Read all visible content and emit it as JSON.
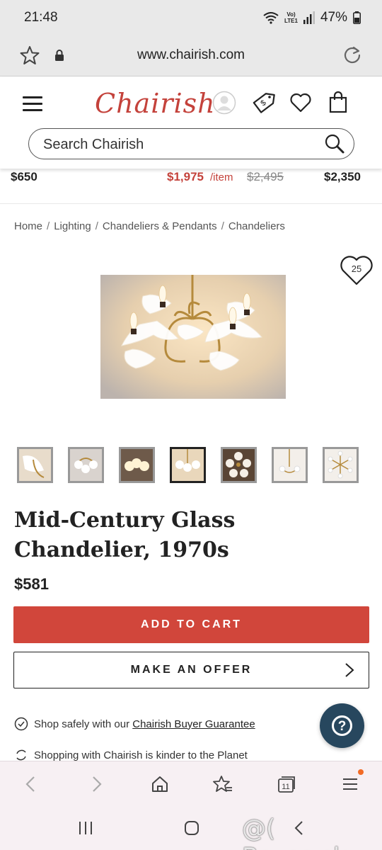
{
  "status_bar": {
    "time": "21:48",
    "network_label_1": "Vo)",
    "network_label_2": "LTE1",
    "battery": "47%"
  },
  "browser": {
    "url": "www.chairish.com",
    "tab_count": "11"
  },
  "header": {
    "logo_text": "Chairish",
    "search_placeholder": "Search Chairish"
  },
  "price_strip": {
    "left_price": "$650",
    "sale_price": "$1,975",
    "per_item": "/item",
    "original_price": "$2,495",
    "right_price": "$2,350"
  },
  "breadcrumb": {
    "items": [
      "Home",
      "Lighting",
      "Chandeliers & Pendants",
      "Chandeliers"
    ],
    "separator": "/"
  },
  "favorite": {
    "count": "25"
  },
  "product": {
    "title": "Mid-Century Glass Chandelier, 1970s",
    "price": "$581",
    "add_to_cart": "ADD TO CART",
    "make_offer": "MAKE AN OFFER"
  },
  "thumbnails": {
    "count": 7,
    "active_index": 3
  },
  "guarantee": {
    "prefix": "Shop safely with our",
    "link": "Chairish Buyer Guarantee"
  },
  "planet_text": "Shopping with Chairish is kinder to the Planet",
  "help_label": "?",
  "watermark": "@( Bazos.sk",
  "colors": {
    "brand_red": "#c4423b",
    "cart_button": "#d1463b",
    "help_bubble": "#27475e",
    "badge_orange": "#f26b25"
  }
}
